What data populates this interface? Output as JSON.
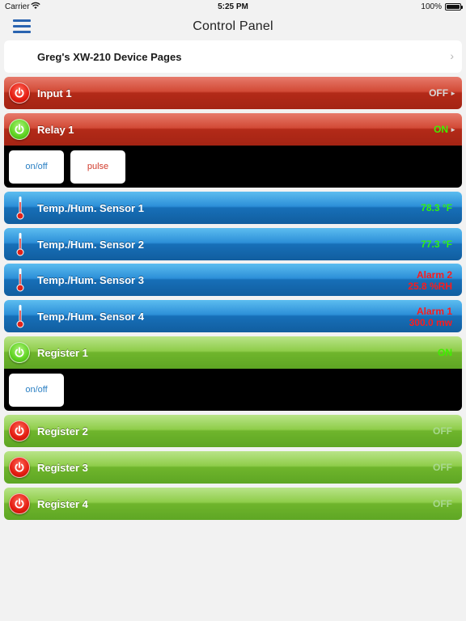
{
  "statusbar": {
    "carrier": "Carrier",
    "time": "5:25 PM",
    "battery": "100%"
  },
  "nav": {
    "title": "Control Panel"
  },
  "device": {
    "label": "Greg's XW-210 Device Pages"
  },
  "rows": [
    {
      "label": "Input 1",
      "status": "OFF",
      "status_color": "#d8d8d8"
    },
    {
      "label": "Relay 1",
      "status": "ON",
      "status_color": "#3ff000"
    },
    {
      "label": "Temp./Hum. Sensor 1",
      "status": "78.3 °F",
      "status_color": "#30f010"
    },
    {
      "label": "Temp./Hum. Sensor 2",
      "status": "77.3 °F",
      "status_color": "#30f010"
    },
    {
      "label": "Temp./Hum. Sensor 3",
      "status": "Alarm 2",
      "status2": "25.8 %RH",
      "status_color": "#ff1a1a"
    },
    {
      "label": "Temp./Hum. Sensor 4",
      "status": "Alarm 1",
      "status2": "300.0 mw",
      "status_color": "#ff1a1a"
    },
    {
      "label": "Register 1",
      "status": "ON",
      "status_color": "#3ff000"
    },
    {
      "label": "Register 2",
      "status": "OFF",
      "status_color": "#a8d890"
    },
    {
      "label": "Register 3",
      "status": "OFF",
      "status_color": "#a8d890"
    },
    {
      "label": "Register 4",
      "status": "OFF",
      "status_color": "#a8d890"
    }
  ],
  "relay_controls": {
    "onoff": "on/off",
    "pulse": "pulse"
  },
  "register_controls": {
    "onoff": "on/off"
  },
  "colors": {
    "accent": "#2a64b0",
    "red": "#c4361f",
    "green": "#7cc23b",
    "blue": "#1f7fc6"
  }
}
